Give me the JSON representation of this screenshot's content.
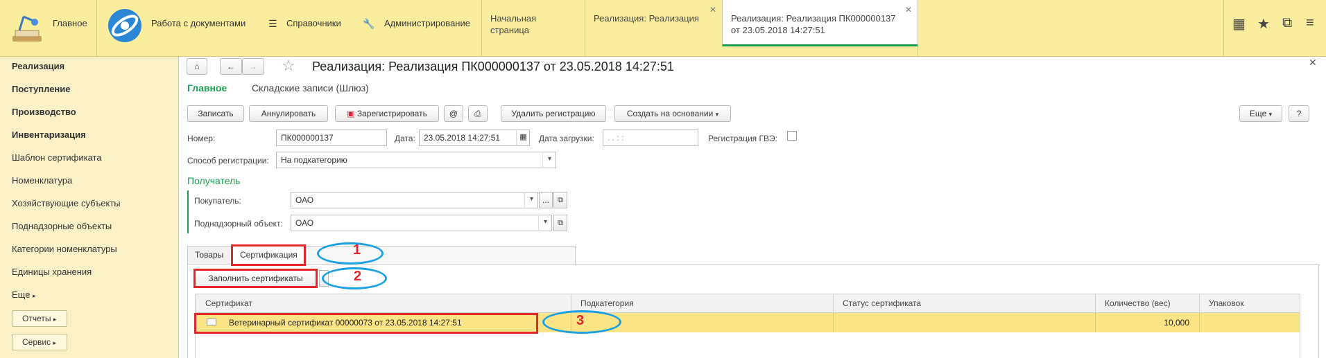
{
  "topbar": {
    "home_label": "Главное",
    "sections": [
      "Работа с документами",
      "Справочники",
      "Администрирование"
    ],
    "tabs": [
      {
        "label": "Начальная страница"
      },
      {
        "label": "Реализация: Реализация"
      },
      {
        "label_line1": "Реализация: Реализация ПК000000137",
        "label_line2": "от 23.05.2018 14:27:51"
      }
    ]
  },
  "sidebar": {
    "items": [
      "Реализация",
      "Поступление",
      "Производство",
      "Инвентаризация",
      "Шаблон сертификата",
      "Номенклатура",
      "Хозяйствующие субъекты",
      "Поднадзорные объекты",
      "Категории номенклатуры",
      "Единицы хранения",
      "Еще"
    ],
    "buttons": [
      "Отчеты",
      "Сервис"
    ]
  },
  "doc": {
    "title": "Реализация: Реализация ПК000000137 от 23.05.2018 14:27:51",
    "links": {
      "main": "Главное",
      "warehouse": "Складские записи (Шлюз)"
    },
    "toolbar": {
      "save": "Записать",
      "cancel": "Аннулировать",
      "register": "Зарегистрировать",
      "email": "@",
      "delete_reg": "Удалить регистрацию",
      "create_based": "Создать на основании",
      "more": "Еще",
      "help": "?"
    },
    "number_label": "Номер:",
    "number_value": "ПК000000137",
    "date_label": "Дата:",
    "date_value": "23.05.2018 14:27:51",
    "load_date_label": "Дата загрузки:",
    "load_date_value": ".  .      :  :",
    "gve_label": "Регистрация ГВЭ:",
    "reg_method_label": "Способ регистрации:",
    "reg_method_value": "На подкатегорию",
    "recipient_title": "Получатель",
    "buyer_label": "Покупатель:",
    "buyer_value": "ОАО",
    "object_label": "Поднадзорный объект:",
    "object_value": "ОАО",
    "tabs": [
      "Товары",
      "Сертификация"
    ],
    "fill_button": "Заполнить сертификаты",
    "columns": [
      "Сертификат",
      "Подкатегория",
      "Статус сертификата",
      "Количество (вес)",
      "Упаковок"
    ],
    "rows": [
      {
        "certificate": "Ветеринарный сертификат 00000073 от 23.05.2018 14:27:51",
        "subcategory": "",
        "status": "",
        "quantity": "10,000",
        "packages": ""
      }
    ]
  },
  "annotations": [
    "1",
    "2",
    "3"
  ],
  "colors": {
    "accent_green": "#1f9d55",
    "topbar": "#fbed9e",
    "sidebar": "#fbf1c6",
    "highlight_row": "#fbe486",
    "annotation_red": "#e2262a",
    "annotation_blue": "#1aa0e4"
  }
}
